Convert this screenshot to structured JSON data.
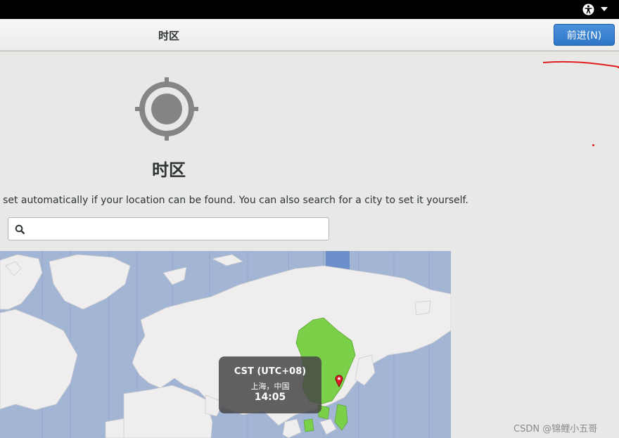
{
  "header": {
    "title": "时区",
    "next_button": "前进(N)"
  },
  "page": {
    "title": "时区",
    "instructions": "e set automatically if your location can be found. You can also search for a city to set it yourself."
  },
  "search": {
    "value": "",
    "placeholder": ""
  },
  "map": {
    "tooltip": {
      "zone": "CST (UTC+08)",
      "city": "上海，中国",
      "time": "14:05"
    },
    "selected_color": "#7bd04a"
  },
  "watermark": "CSDN @锦鲤小五哥",
  "icons": {
    "accessibility": "accessibility-icon",
    "menu": "chevron-down-icon",
    "timezone": "crosshair-location-icon",
    "search": "search-icon",
    "pin": "location-pin-icon"
  },
  "colors": {
    "accent": "#3584e4",
    "ocean": "#a2b5d5",
    "land": "#efeded",
    "annotation": "#e02020"
  }
}
